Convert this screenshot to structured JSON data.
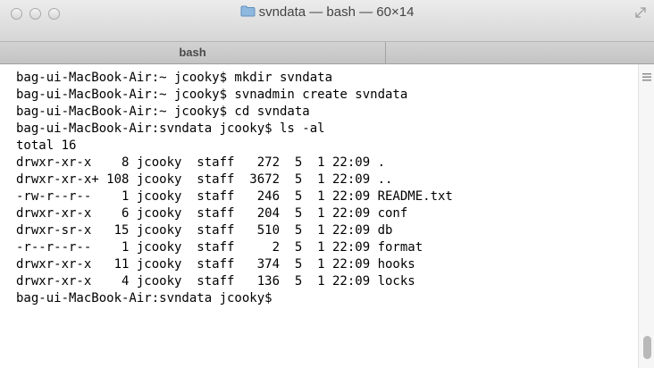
{
  "window": {
    "title": "svndata — bash — 60×14"
  },
  "tabs": [
    {
      "label": "bash"
    }
  ],
  "terminal": {
    "lines": [
      "bag-ui-MacBook-Air:~ jcooky$ mkdir svndata",
      "bag-ui-MacBook-Air:~ jcooky$ svnadmin create svndata",
      "bag-ui-MacBook-Air:~ jcooky$ cd svndata",
      "bag-ui-MacBook-Air:svndata jcooky$ ls -al",
      "total 16",
      "drwxr-xr-x    8 jcooky  staff   272  5  1 22:09 .",
      "drwxr-xr-x+ 108 jcooky  staff  3672  5  1 22:09 ..",
      "-rw-r--r--    1 jcooky  staff   246  5  1 22:09 README.txt",
      "drwxr-xr-x    6 jcooky  staff   204  5  1 22:09 conf",
      "drwxr-sr-x   15 jcooky  staff   510  5  1 22:09 db",
      "-r--r--r--    1 jcooky  staff     2  5  1 22:09 format",
      "drwxr-xr-x   11 jcooky  staff   374  5  1 22:09 hooks",
      "drwxr-xr-x    4 jcooky  staff   136  5  1 22:09 locks",
      "bag-ui-MacBook-Air:svndata jcooky$ "
    ]
  },
  "icons": {
    "close": "close-button-icon",
    "minimize": "minimize-button-icon",
    "zoom": "zoom-button-icon",
    "folder": "folder-icon",
    "fullscreen": "fullscreen-icon",
    "scroll_menu": "menu-icon"
  },
  "colors": {
    "folder": "#8fb8df",
    "titlebar_top": "#ececec",
    "titlebar_bottom": "#d6d6d6"
  }
}
